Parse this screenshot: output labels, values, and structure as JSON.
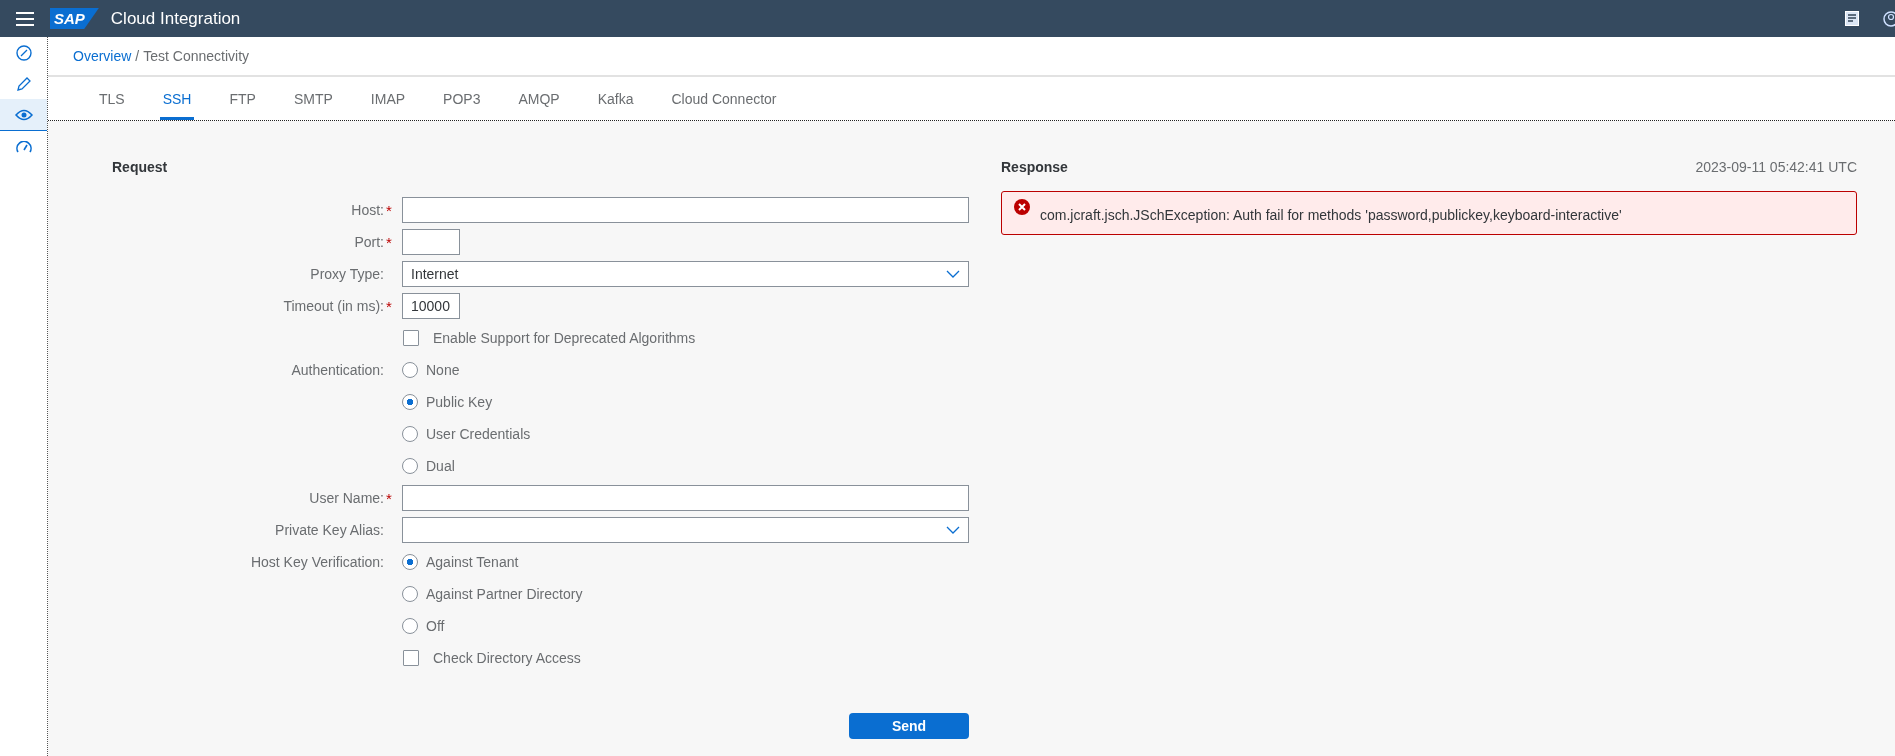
{
  "shell": {
    "logo": "SAP",
    "title": "Cloud Integration"
  },
  "sidebar": {
    "items": [
      {
        "selected": false
      },
      {
        "selected": false
      },
      {
        "selected": true
      },
      {
        "selected": false
      }
    ]
  },
  "breadcrumb": {
    "link": "Overview",
    "separator": "/",
    "current": "Test Connectivity"
  },
  "tabs": [
    {
      "label": "TLS",
      "selected": false
    },
    {
      "label": "SSH",
      "selected": true
    },
    {
      "label": "FTP",
      "selected": false
    },
    {
      "label": "SMTP",
      "selected": false
    },
    {
      "label": "IMAP",
      "selected": false
    },
    {
      "label": "POP3",
      "selected": false
    },
    {
      "label": "AMQP",
      "selected": false
    },
    {
      "label": "Kafka",
      "selected": false
    },
    {
      "label": "Cloud Connector",
      "selected": false
    }
  ],
  "request": {
    "heading": "Request",
    "fields": [
      {
        "kind": "text",
        "label": "Host:",
        "required_mark": "*"
      },
      {
        "kind": "short-text",
        "label": "Port:",
        "required_mark": "*"
      },
      {
        "kind": "select",
        "label": "Proxy Type:",
        "value": "Internet"
      },
      {
        "kind": "short-text",
        "label": "Timeout (in ms):",
        "required_mark": "*",
        "value": "10000"
      },
      {
        "kind": "checkbox",
        "text": "Enable Support for Deprecated Algorithms",
        "checked": false
      },
      {
        "kind": "radio",
        "label": "Authentication:",
        "options": [
          {
            "text": "None",
            "selected": false
          },
          {
            "text": "Public Key",
            "selected": true
          },
          {
            "text": "User Credentials",
            "selected": false
          },
          {
            "text": "Dual",
            "selected": false
          }
        ]
      },
      {
        "kind": "text",
        "label": "User Name:",
        "required_mark": "*"
      },
      {
        "kind": "select",
        "label": "Private Key Alias:"
      },
      {
        "kind": "radio",
        "label": "Host Key Verification:",
        "options": [
          {
            "text": "Against Tenant",
            "selected": true
          },
          {
            "text": "Against Partner Directory",
            "selected": false
          },
          {
            "text": "Off",
            "selected": false
          }
        ]
      },
      {
        "kind": "checkbox",
        "text": "Check Directory Access",
        "checked": false
      }
    ],
    "button": "Send"
  },
  "response": {
    "heading": "Response",
    "timestamp": "2023-09-11 05:42:41 UTC",
    "message": {
      "kind": "error",
      "text": "com.jcraft.jsch.JSchException: Auth fail for methods 'password,publickey,keyboard-interactive'"
    }
  }
}
